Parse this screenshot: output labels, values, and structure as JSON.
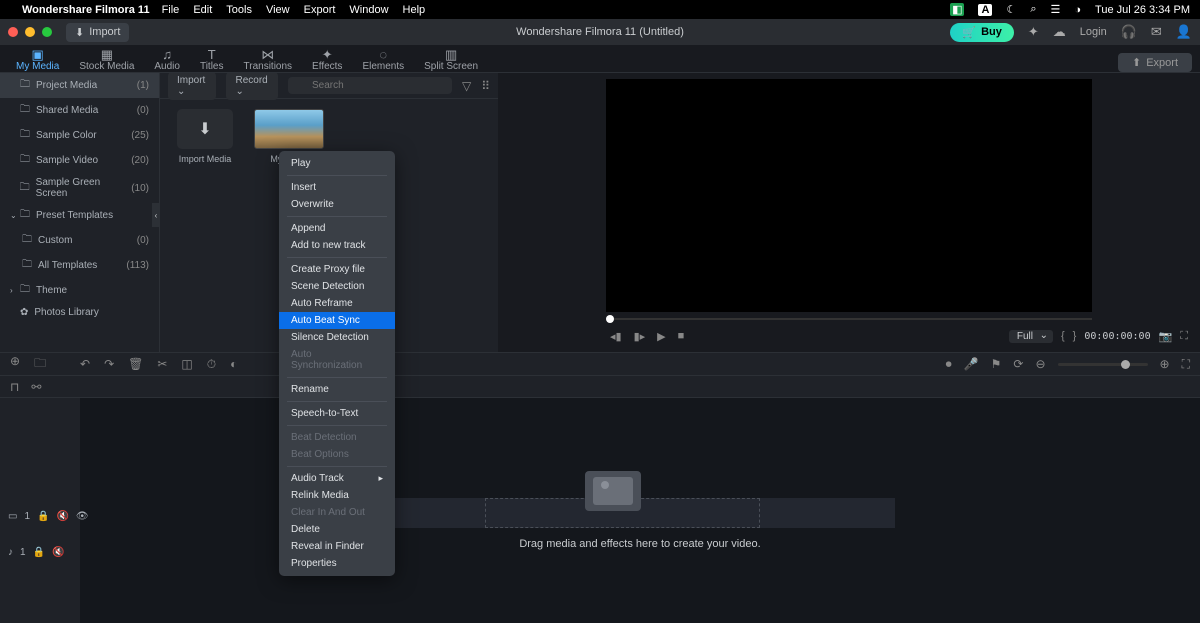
{
  "menubar": {
    "appname": "Wondershare Filmora 11",
    "items": [
      "File",
      "Edit",
      "Tools",
      "View",
      "Export",
      "Window",
      "Help"
    ],
    "datetime": "Tue Jul 26  3:34 PM"
  },
  "titlebar": {
    "import": "Import",
    "doc_title": "Wondershare Filmora 11 (Untitled)",
    "buy": "Buy",
    "login": "Login"
  },
  "tabs": [
    {
      "label": "My Media",
      "active": true
    },
    {
      "label": "Stock Media"
    },
    {
      "label": "Audio"
    },
    {
      "label": "Titles"
    },
    {
      "label": "Transitions"
    },
    {
      "label": "Effects"
    },
    {
      "label": "Elements"
    },
    {
      "label": "Split Screen"
    }
  ],
  "export": "Export",
  "sidebar": {
    "items": [
      {
        "label": "Project Media",
        "count": "(1)",
        "active": true
      },
      {
        "label": "Shared Media",
        "count": "(0)"
      },
      {
        "label": "Sample Color",
        "count": "(25)"
      },
      {
        "label": "Sample Video",
        "count": "(20)"
      },
      {
        "label": "Sample Green Screen",
        "count": "(10)"
      },
      {
        "label": "Preset Templates",
        "expandable": true,
        "expanded": true
      },
      {
        "label": "Custom",
        "count": "(0)",
        "sub": true
      },
      {
        "label": "All Templates",
        "count": "(113)",
        "sub": true
      },
      {
        "label": "Theme",
        "expandable": true,
        "expanded": false
      },
      {
        "label": "Photos Library",
        "icon": "flower"
      }
    ]
  },
  "media_panel": {
    "import_dd": "Import",
    "record_dd": "Record",
    "search_placeholder": "Search",
    "import_media": "Import Media",
    "clip_label": "My Video"
  },
  "preview": {
    "quality": "Full",
    "timecode": "00:00:00:00",
    "markers": {
      "open": "{",
      "close": "}"
    }
  },
  "timeline": {
    "video_track": "1",
    "audio_track": "1",
    "drop_text": "Drag media and effects here to create your video."
  },
  "context_menu": {
    "groups": [
      [
        {
          "t": "Play"
        }
      ],
      [
        {
          "t": "Insert"
        },
        {
          "t": "Overwrite"
        }
      ],
      [
        {
          "t": "Append"
        },
        {
          "t": "Add to new track"
        }
      ],
      [
        {
          "t": "Create Proxy file"
        },
        {
          "t": "Scene Detection"
        },
        {
          "t": "Auto Reframe"
        },
        {
          "t": "Auto Beat Sync",
          "hl": true
        },
        {
          "t": "Silence Detection"
        },
        {
          "t": "Auto Synchronization",
          "dis": true
        }
      ],
      [
        {
          "t": "Rename"
        }
      ],
      [
        {
          "t": "Speech-to-Text"
        }
      ],
      [
        {
          "t": "Beat Detection",
          "dis": true
        },
        {
          "t": "Beat Options",
          "dis": true
        }
      ],
      [
        {
          "t": "Audio Track",
          "arrow": true
        },
        {
          "t": "Relink Media"
        },
        {
          "t": "Clear In And Out",
          "dis": true
        },
        {
          "t": "Delete"
        },
        {
          "t": "Reveal in Finder"
        },
        {
          "t": "Properties"
        }
      ]
    ]
  }
}
